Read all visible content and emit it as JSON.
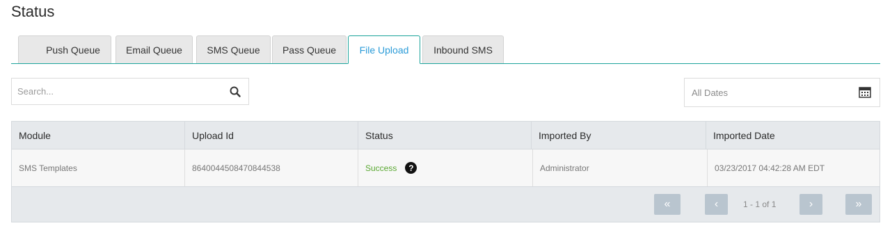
{
  "page": {
    "title": "Status"
  },
  "tabs": [
    {
      "label": "Push Queue"
    },
    {
      "label": "Email Queue"
    },
    {
      "label": "SMS Queue"
    },
    {
      "label": "Pass Queue"
    },
    {
      "label": "File Upload",
      "active": true
    },
    {
      "label": "Inbound SMS"
    }
  ],
  "search": {
    "placeholder": "Search...",
    "value": "",
    "icon": "search-icon"
  },
  "date_filter": {
    "label": "All Dates",
    "icon": "calendar-icon"
  },
  "grid": {
    "columns": [
      "Module",
      "Upload Id",
      "Status",
      "Imported By",
      "Imported Date"
    ],
    "rows": [
      {
        "module": "SMS Templates",
        "upload_id": "8640044508470844538",
        "status": "Success",
        "imported_by": "Administrator",
        "imported_date": "03/23/2017 04:42:28 AM EDT"
      }
    ]
  },
  "pager": {
    "info": "1 - 1 of 1",
    "first_label": "«",
    "prev_label": "‹",
    "next_label": "›",
    "last_label": "»"
  },
  "colors": {
    "accent": "#1aa39a",
    "active_tab_text": "#2a9bd8",
    "success": "#5aa832",
    "pager_button": "#b9c5cf"
  }
}
